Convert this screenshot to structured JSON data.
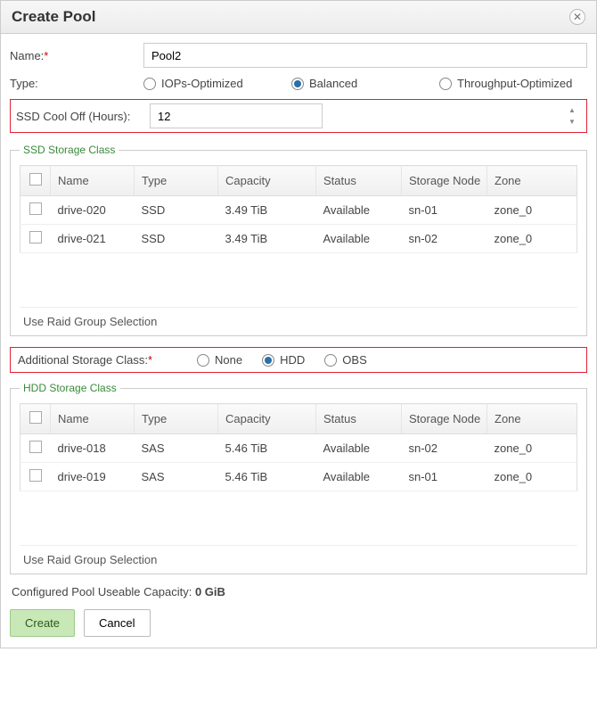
{
  "dialog": {
    "title": "Create Pool"
  },
  "form": {
    "name_label": "Name:",
    "name_value": "Pool2",
    "type_label": "Type:",
    "type_options": {
      "iops": "IOPs-Optimized",
      "balanced": "Balanced",
      "throughput": "Throughput-Optimized"
    },
    "type_selected": "balanced",
    "cooloff_label": "SSD Cool Off (Hours):",
    "cooloff_value": "12"
  },
  "ssd_section": {
    "legend": "SSD Storage Class",
    "columns": {
      "name": "Name",
      "type": "Type",
      "capacity": "Capacity",
      "status": "Status",
      "node": "Storage Node",
      "zone": "Zone"
    },
    "rows": [
      {
        "name": "drive-020",
        "type": "SSD",
        "capacity": "3.49 TiB",
        "status": "Available",
        "node": "sn-01",
        "zone": "zone_0"
      },
      {
        "name": "drive-021",
        "type": "SSD",
        "capacity": "3.49 TiB",
        "status": "Available",
        "node": "sn-02",
        "zone": "zone_0"
      }
    ],
    "raid_link": "Use Raid Group Selection"
  },
  "additional": {
    "label": "Additional Storage Class:",
    "options": {
      "none": "None",
      "hdd": "HDD",
      "obs": "OBS"
    },
    "selected": "hdd"
  },
  "hdd_section": {
    "legend": "HDD Storage Class",
    "columns": {
      "name": "Name",
      "type": "Type",
      "capacity": "Capacity",
      "status": "Status",
      "node": "Storage Node",
      "zone": "Zone"
    },
    "rows": [
      {
        "name": "drive-018",
        "type": "SAS",
        "capacity": "5.46 TiB",
        "status": "Available",
        "node": "sn-02",
        "zone": "zone_0"
      },
      {
        "name": "drive-019",
        "type": "SAS",
        "capacity": "5.46 TiB",
        "status": "Available",
        "node": "sn-01",
        "zone": "zone_0"
      }
    ],
    "raid_link": "Use Raid Group Selection"
  },
  "capacity": {
    "label": "Configured Pool Useable Capacity:",
    "value": "0 GiB"
  },
  "buttons": {
    "create": "Create",
    "cancel": "Cancel"
  }
}
